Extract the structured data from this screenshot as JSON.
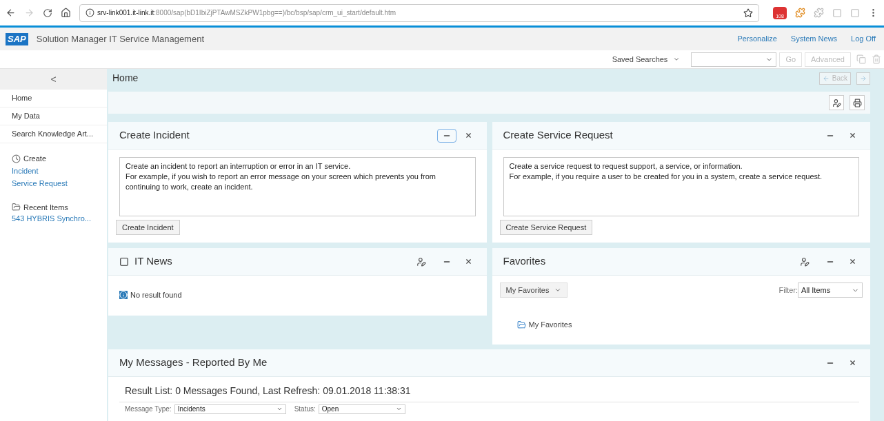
{
  "browser": {
    "url_host": "srv-link001.it-link.it",
    "url_rest": ":8000/sap(bD1IbiZjPTAwMSZkPW1pbg==)/bc/bsp/sap/crm_ui_start/default.htm",
    "mail_badge": "108"
  },
  "header": {
    "title": "Solution Manager IT Service Management",
    "logo": "SAP",
    "links": [
      "Personalize",
      "System News",
      "Log Off"
    ]
  },
  "toolbar": {
    "saved_searches": "Saved Searches",
    "go": "Go",
    "advanced": "Advanced"
  },
  "page": {
    "title": "Home",
    "back": "Back"
  },
  "sidebar": {
    "collapse": "<",
    "items": [
      {
        "label": "Home",
        "selected": false
      },
      {
        "label": "My Data",
        "selected": false
      },
      {
        "label": "Search Knowledge Art...",
        "selected": false
      }
    ],
    "create": {
      "label": "Create",
      "links": [
        "Incident",
        "Service Request"
      ]
    },
    "recent": {
      "label": "Recent Items",
      "links": [
        "543 HYBRIS Synchro..."
      ]
    }
  },
  "create_incident": {
    "title": "Create Incident",
    "description": "Create an incident to report an interruption or error in an IT service.\nFor example, if you wish to report an error message on your screen which prevents you from continuing to work, create an incident.",
    "button": "Create Incident",
    "minimize_focused": true
  },
  "create_request": {
    "title": "Create Service Request",
    "description": "Create a service request to request support, a service, or information.\nFor example, if you require a user to be created for you in a system, create a service request.",
    "button": "Create Service Request",
    "minimize_focused": false
  },
  "it_news": {
    "title": "IT News",
    "message": "No result found",
    "minimize_focused": false
  },
  "favorites": {
    "title": "Favorites",
    "menu": "My Favorites",
    "filter_label": "Filter:",
    "filter_value": "All Items",
    "folder": "My Favorites",
    "minimize_focused": false
  },
  "messages": {
    "title": "My Messages - Reported By Me",
    "result": "Result List: 0 Messages Found, Last Refresh: 09.01.2018 11:38:31",
    "filters": [
      {
        "label": "Message Type:",
        "value": "Incidents"
      },
      {
        "label": "Status:",
        "value": "Open"
      }
    ],
    "minimize_focused": false
  }
}
